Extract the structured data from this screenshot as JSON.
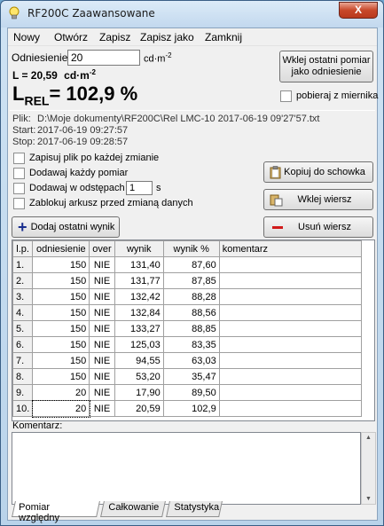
{
  "window": {
    "title": "RF200C Zaawansowane",
    "close_symbol": "X"
  },
  "menu": {
    "items": [
      "Nowy",
      "Otwórz",
      "Zapisz",
      "Zapisz jako",
      "Zamknij"
    ]
  },
  "reference": {
    "label": "Odniesienie:",
    "value": "20",
    "unit": "cd·m",
    "unit_exp": "-2"
  },
  "luminance": {
    "label": "L = ",
    "value": "20,59",
    "unit": "cd·m",
    "unit_exp": "-2"
  },
  "lrel": {
    "label": "L",
    "sub": "REL",
    "value": "= 102,9 %"
  },
  "paste_button": {
    "label_line1": "Wklej ostatni pomiar",
    "label_line2": "jako odniesienie"
  },
  "fetch_from_meter": {
    "label": "pobieraj z miernika",
    "checked": false
  },
  "file_info": {
    "file_label": "Plik:",
    "file_path": "D:\\Moje dokumenty\\RF200C\\Rel LMC-10 2017-06-19 09'27'57.txt",
    "start_label": "Start:",
    "start_value": "2017-06-19 09:27:57",
    "stop_label": "Stop:",
    "stop_value": "2017-06-19 09:28:57"
  },
  "options": {
    "save_each_change": "Zapisuj plik po każdej zmianie",
    "add_each": "Dodawaj każdy pomiar",
    "add_interval": "Dodawaj w odstępach",
    "interval_value": "1",
    "interval_unit": "s",
    "lock_sheet": "Zablokuj arkusz przed zmianą danych"
  },
  "buttons": {
    "copy": "Kopiuj do schowka",
    "paste_row": "Wklej wiersz",
    "delete_row": "Usuń wiersz",
    "add_last": "Dodaj ostatni wynik"
  },
  "table": {
    "headers": [
      "l.p.",
      "odniesienie",
      "over",
      "wynik",
      "wynik %",
      "komentarz"
    ],
    "rows": [
      [
        "1.",
        "150",
        "NIE",
        "131,40",
        "87,60",
        ""
      ],
      [
        "2.",
        "150",
        "NIE",
        "131,77",
        "87,85",
        ""
      ],
      [
        "3.",
        "150",
        "NIE",
        "132,42",
        "88,28",
        ""
      ],
      [
        "4.",
        "150",
        "NIE",
        "132,84",
        "88,56",
        ""
      ],
      [
        "5.",
        "150",
        "NIE",
        "133,27",
        "88,85",
        ""
      ],
      [
        "6.",
        "150",
        "NIE",
        "125,03",
        "83,35",
        ""
      ],
      [
        "7.",
        "150",
        "NIE",
        "94,55",
        "63,03",
        ""
      ],
      [
        "8.",
        "150",
        "NIE",
        "53,20",
        "35,47",
        ""
      ],
      [
        "9.",
        "20",
        "NIE",
        "17,90",
        "89,50",
        ""
      ],
      [
        "10.",
        "20",
        "NIE",
        "20,59",
        "102,9",
        ""
      ]
    ]
  },
  "comment": {
    "label": "Komentarz:",
    "value": ""
  },
  "tabs": [
    "Pomiar względny",
    "Całkowanie",
    "Statystyka"
  ],
  "colors": {
    "add_icon": "#1a2f8f",
    "delete_icon": "#d11a1a"
  }
}
